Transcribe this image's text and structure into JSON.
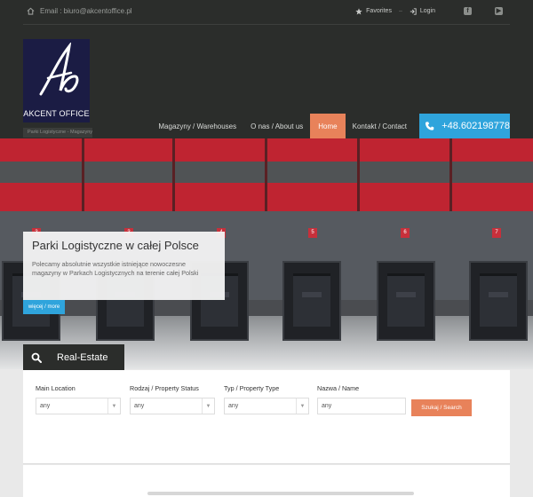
{
  "topbar": {
    "email": "Email : biuro@akcentoffice.pl",
    "favorites": "Favorites",
    "login": "Login",
    "social_icons": [
      "facebook-icon",
      "youtube-icon"
    ]
  },
  "logo": {
    "text": "AKCENT OFFICE",
    "monogram": "A",
    "bg_color": "#1b1c44"
  },
  "breadcrumb": "Parki Logistyczne - Magazyny",
  "nav": {
    "items": [
      {
        "label": "Magazyny / Warehouses"
      },
      {
        "label": "O nas / About us"
      },
      {
        "label": "Home"
      },
      {
        "label": "Kontakt / Contact"
      }
    ],
    "active": "Home",
    "phone": "+48.602198778",
    "accent_color": "#e8825a",
    "phone_color": "#2fa4dc"
  },
  "hero": {
    "caption_title": "Parki Logistyczne w całej Polsce",
    "caption_text": "Polecamy absolutnie wszystkie istniejące nowoczesne magazyny w Parkach Logistycznych na terenie całej Polski",
    "button": "więcej / more",
    "dock_numbers": [
      "3",
      "3",
      "4",
      "5",
      "6",
      "7"
    ]
  },
  "search": {
    "tab_label": "Real-Estate",
    "fields": [
      {
        "label": "Main Location",
        "value": "any"
      },
      {
        "label": "Rodzaj / Property Status",
        "value": "any"
      },
      {
        "label": "Typ / Property Type",
        "value": "any"
      },
      {
        "label": "Nazwa / Name",
        "placeholder": "any"
      }
    ],
    "button": "Szukaj / Search"
  }
}
